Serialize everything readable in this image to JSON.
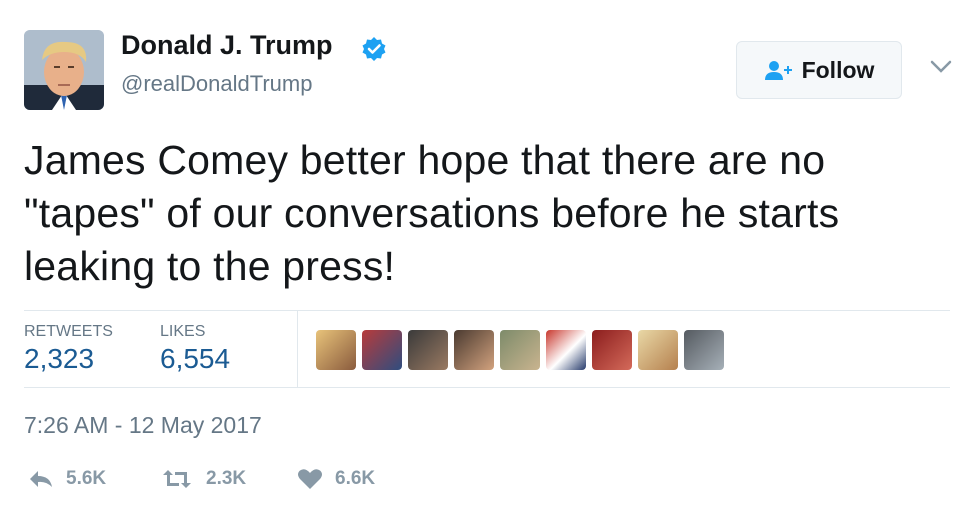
{
  "user": {
    "display_name": "Donald J. Trump",
    "handle": "@realDonaldTrump",
    "verified_icon": "verified-badge-icon",
    "avatar_icon": "profile-avatar"
  },
  "follow": {
    "label": "Follow",
    "icon": "add-user-icon"
  },
  "tweet": {
    "text": "James Comey better hope that there are no \"tapes\" of our conversations before he starts leaking to the press!"
  },
  "stats": {
    "retweets_label": "RETWEETS",
    "retweets_value": "2,323",
    "likes_label": "LIKES",
    "likes_value": "6,554"
  },
  "timestamp": "7:26 AM - 12 May 2017",
  "actions": {
    "reply_count": "5.6K",
    "retweet_count": "2.3K",
    "like_count": "6.6K"
  },
  "colors": {
    "accent": "#1da1f2",
    "stat_value": "#1b5b93",
    "muted": "#657786",
    "action_gray": "#8899a6"
  }
}
